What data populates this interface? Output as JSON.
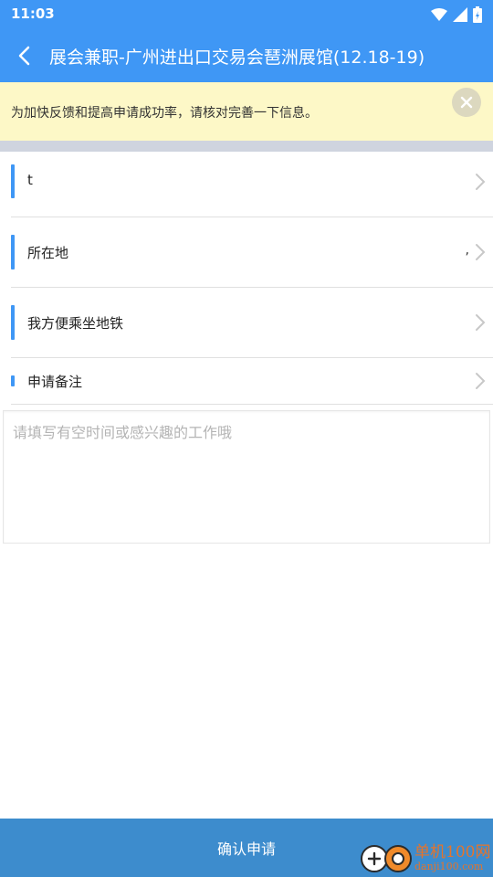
{
  "status_bar": {
    "time": "11:03"
  },
  "header": {
    "title": "展会兼职-广州进出口交易会琶洲展馆(12.18-19)"
  },
  "notice": {
    "text": "为加快反馈和提高申请成功率，请核对完善一下信息。"
  },
  "rows": [
    {
      "label": "t",
      "value": ""
    },
    {
      "label": "所在地",
      "value": ","
    },
    {
      "label": "我方便乘坐地铁",
      "value": ""
    },
    {
      "label": "申请备注",
      "value": ""
    }
  ],
  "notes": {
    "placeholder": "请填写有空时间或感兴趣的工作哦",
    "value": ""
  },
  "confirm": {
    "label": "确认申请"
  },
  "watermark": {
    "line1": "单机100网",
    "line2": "danji100.com"
  },
  "colors": {
    "primary": "#3f97f5",
    "notice_bg": "#fdf8c7",
    "confirm_bg": "#3d8ccd",
    "watermark": "#e5742b"
  }
}
